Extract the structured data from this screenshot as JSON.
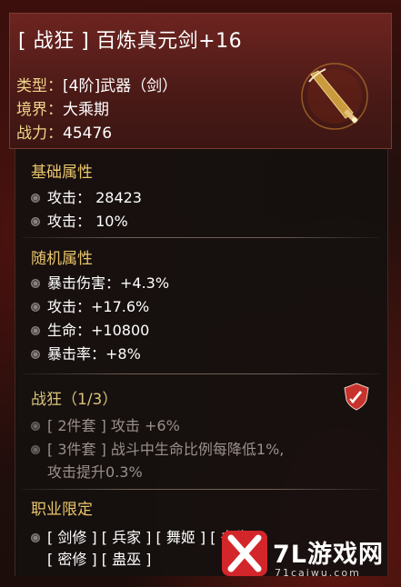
{
  "item": {
    "title": "[ 战狂 ] 百炼真元剑+16",
    "type_label": "类型：",
    "type_value": "[4阶]武器（剑）",
    "realm_label": "境界：",
    "realm_value": "大乘期",
    "power_label": "战力：",
    "power_value": "45476",
    "emblem_icon": "sword-icon"
  },
  "base_attrs": {
    "title": "基础属性",
    "lines": [
      "攻击：  28423",
      "攻击：  10%"
    ]
  },
  "random_attrs": {
    "title": "随机属性",
    "lines": [
      "暴击伤害：+4.3%",
      "攻击：+17.6%",
      "生命：+10800",
      "暴击率：+8%"
    ]
  },
  "set_bonus": {
    "title": "战狂（1/3）",
    "icon": "shield-sword-icon",
    "lines": [
      "[ 2件套 ] 攻击 +6%",
      "[ 3件套 ] 战斗中生命比例每降低1%,",
      "攻击提升0.3%"
    ]
  },
  "class_limit": {
    "title": "职业限定",
    "row1": "[ 剑修 ] [ 兵家 ] [ 舞姬 ] [ 书生 ]",
    "row2": "[ 密修 ] [ 蛊巫 ]"
  },
  "watermark": {
    "brand": "7L游戏网",
    "url": "71caiwu.com"
  },
  "colors": {
    "gold": "#e9c56b",
    "header_bg": "#6e2420",
    "panel_bg": "#141010"
  }
}
